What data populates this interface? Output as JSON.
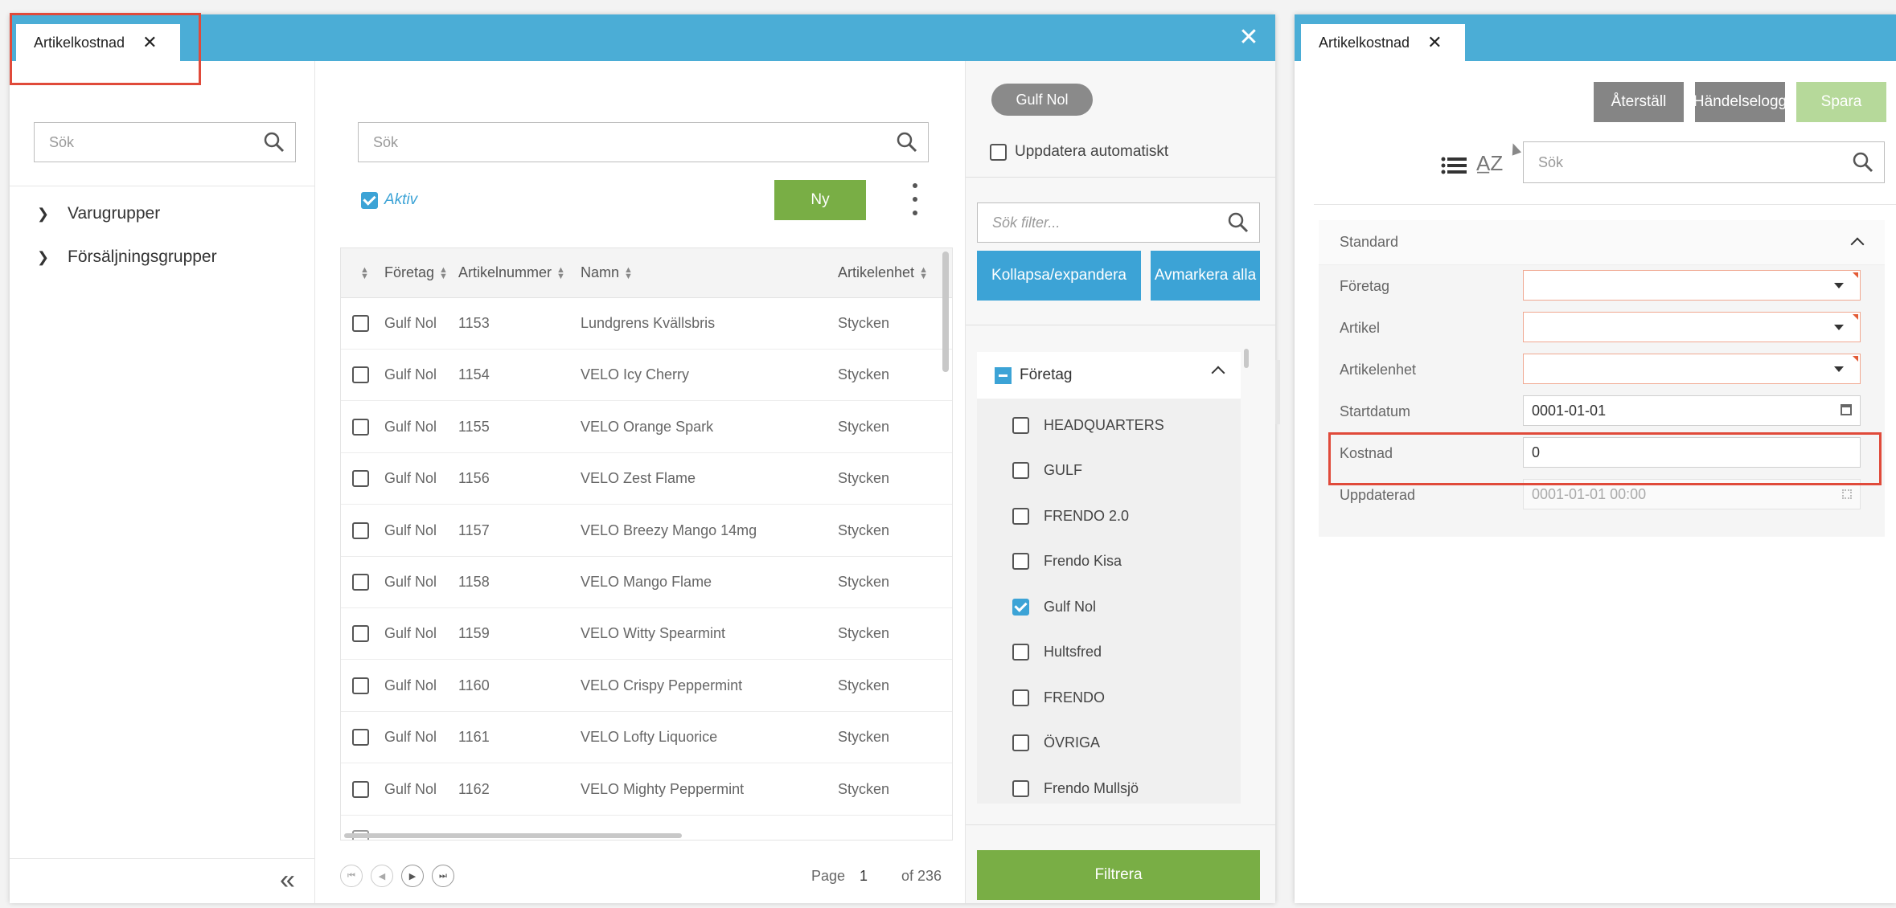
{
  "left_window": {
    "tab_title": "Artikelkostnad",
    "close_icon": "✕",
    "tree": {
      "search_placeholder": "Sök",
      "items": [
        {
          "label": "Varugrupper"
        },
        {
          "label": "Försäljningsgrupper"
        }
      ],
      "collapse_icon": "«"
    },
    "grid": {
      "search_placeholder": "Sök",
      "aktiv_label": "Aktiv",
      "aktiv_checked": true,
      "new_button": "Ny",
      "columns": [
        "Företag",
        "Artikelnummer",
        "Namn",
        "Artikelenhet"
      ],
      "rows": [
        {
          "company": "Gulf Nol",
          "number": "1153",
          "name": "Lundgrens Kvällsbris",
          "unit": "Stycken"
        },
        {
          "company": "Gulf Nol",
          "number": "1154",
          "name": "VELO Icy Cherry",
          "unit": "Stycken"
        },
        {
          "company": "Gulf Nol",
          "number": "1155",
          "name": "VELO Orange Spark",
          "unit": "Stycken"
        },
        {
          "company": "Gulf Nol",
          "number": "1156",
          "name": "VELO Zest Flame",
          "unit": "Stycken"
        },
        {
          "company": "Gulf Nol",
          "number": "1157",
          "name": "VELO Breezy Mango 14mg",
          "unit": "Stycken"
        },
        {
          "company": "Gulf Nol",
          "number": "1158",
          "name": "VELO Mango Flame",
          "unit": "Stycken"
        },
        {
          "company": "Gulf Nol",
          "number": "1159",
          "name": "VELO Witty Spearmint",
          "unit": "Stycken"
        },
        {
          "company": "Gulf Nol",
          "number": "1160",
          "name": "VELO Crispy Peppermint",
          "unit": "Stycken"
        },
        {
          "company": "Gulf Nol",
          "number": "1161",
          "name": "VELO Lofty Liquorice",
          "unit": "Stycken"
        },
        {
          "company": "Gulf Nol",
          "number": "1162",
          "name": "VELO Mighty Peppermint",
          "unit": "Stycken"
        }
      ],
      "pager": {
        "page_label": "Page",
        "page": "1",
        "of_label": "of 236"
      }
    },
    "filter": {
      "chip": "Gulf Nol",
      "auto_update_label": "Uppdatera automatiskt",
      "search_placeholder": "Sök filter...",
      "collapse_expand_button": "Kollapsa/expandera",
      "uncheck_all_button": "Avmarkera alla",
      "group_label": "Företag",
      "companies": [
        {
          "label": "HEADQUARTERS",
          "checked": false
        },
        {
          "label": "GULF",
          "checked": false
        },
        {
          "label": "FRENDO 2.0",
          "checked": false
        },
        {
          "label": "Frendo Kisa",
          "checked": false
        },
        {
          "label": "Gulf Nol",
          "checked": true
        },
        {
          "label": "Hultsfred",
          "checked": false
        },
        {
          "label": "FRENDO",
          "checked": false
        },
        {
          "label": "ÖVRIGA",
          "checked": false
        },
        {
          "label": "Frendo Mullsjö",
          "checked": false
        }
      ],
      "filter_button": "Filtrera"
    }
  },
  "right_window": {
    "tab_title": "Artikelkostnad",
    "close_icon": "✕",
    "buttons": {
      "reset": "Återställ",
      "event_log": "Händelselogg",
      "save": "Spara"
    },
    "search_placeholder": "Sök",
    "section_title": "Standard",
    "fields": {
      "foretag_label": "Företag",
      "artikel_label": "Artikel",
      "artikelenhet_label": "Artikelenhet",
      "startdatum_label": "Startdatum",
      "startdatum_value": "0001-01-01",
      "kostnad_label": "Kostnad",
      "kostnad_value": "0",
      "uppdaterad_label": "Uppdaterad",
      "uppdaterad_value": "0001-01-01 00:00"
    }
  },
  "colors": {
    "titlebar": "#4badd6",
    "green": "#79ae45",
    "blue": "#3ca3d6",
    "highlight": "#e04a3a"
  }
}
